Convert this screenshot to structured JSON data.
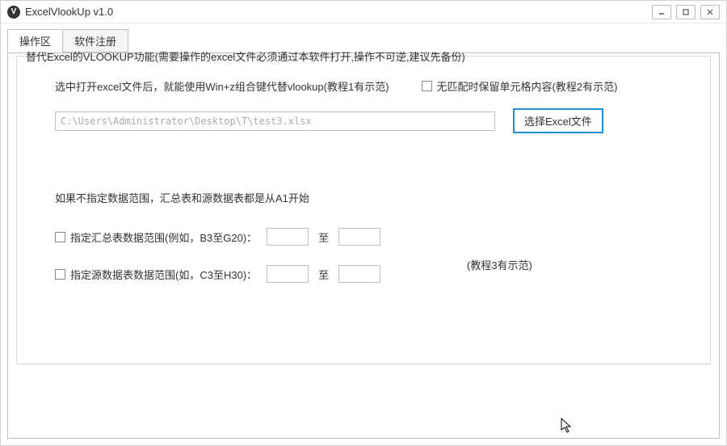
{
  "window": {
    "title": "ExcelVlookUp v1.0",
    "minimize": "—",
    "maximize": "☐",
    "close": "✕"
  },
  "tabs": {
    "operation": "操作区",
    "register": "软件注册"
  },
  "group": {
    "title": "替代Excel的VLOOKUP功能(需要操作的excel文件必须通过本软件打开,操作不可逆,建议先备份)"
  },
  "hint1": "选中打开excel文件后，就能使用Win+z组合键代替vlookup(教程1有示范)",
  "checkbox_keep": "无匹配时保留单元格内容(教程2有示范)",
  "file": {
    "path": "C:\\Users\\Administrator\\Desktop\\T\\test3.xlsx",
    "button": "选择Excel文件"
  },
  "hint2": "如果不指定数据范围，汇总表和源数据表都是从A1开始",
  "range1": {
    "label": "指定汇总表数据范围(例如，B3至G20)：",
    "sep": "至"
  },
  "range2": {
    "label": "指定源数据表数据范围(如，C3至H30)：",
    "sep": "至"
  },
  "tutorial3": "(教程3有示范)"
}
